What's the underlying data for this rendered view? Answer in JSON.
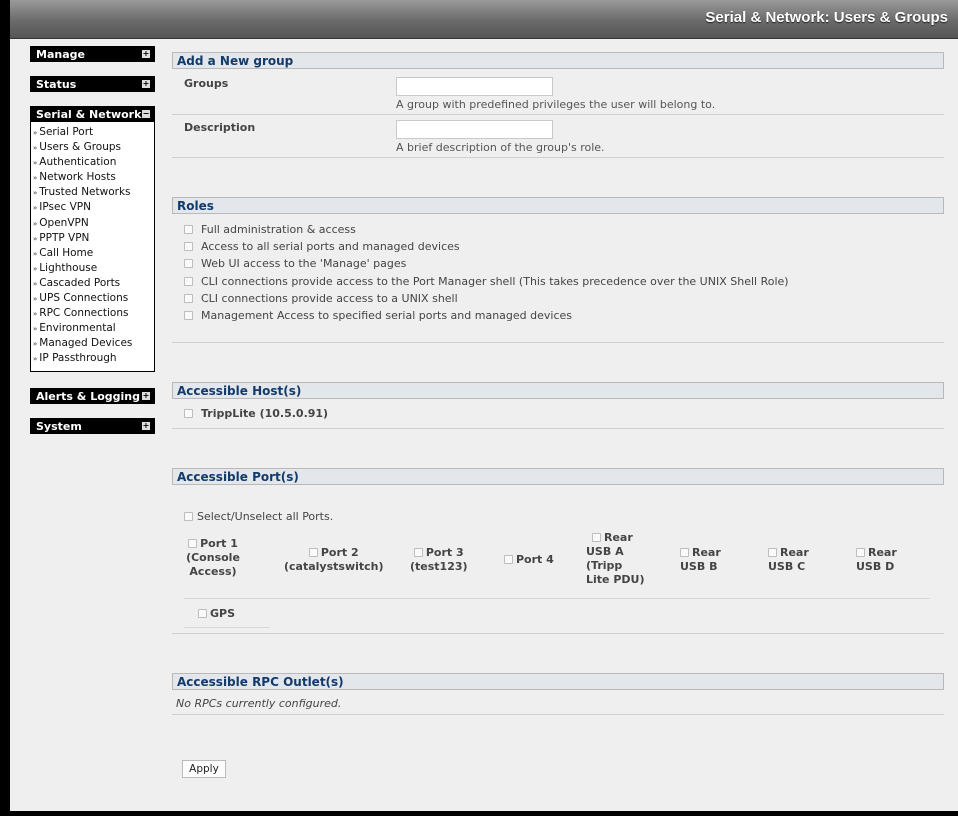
{
  "window": {
    "title": "Serial & Network: Users & Groups"
  },
  "sidebar": {
    "manage": "Manage",
    "status": "Status",
    "serial_network": "Serial & Network",
    "items": [
      "Serial Port",
      "Users & Groups",
      "Authentication",
      "Network Hosts",
      "Trusted Networks",
      "IPsec VPN",
      "OpenVPN",
      "PPTP VPN",
      "Call Home",
      "Lighthouse",
      "Cascaded Ports",
      "UPS Connections",
      "RPC Connections",
      "Environmental",
      "Managed Devices",
      "IP Passthrough"
    ],
    "alerts_logging": "Alerts & Logging",
    "system": "System",
    "toggle_collapsed": "+",
    "toggle_expanded": "−"
  },
  "add_group": {
    "heading": "Add a New group",
    "groups_label": "Groups",
    "groups_value": "",
    "groups_hint": "A group with predefined privileges the user will belong to.",
    "description_label": "Description",
    "description_value": "",
    "description_hint": "A brief description of the group's role."
  },
  "roles": {
    "heading": "Roles",
    "items": [
      "Full administration & access",
      "Access to all serial ports and managed devices",
      "Web UI access to the 'Manage' pages",
      "CLI connections provide access to the Port Manager shell (This takes precedence over the UNIX Shell Role)",
      "CLI connections provide access to a UNIX shell",
      "Management Access to specified serial ports and managed devices"
    ]
  },
  "hosts": {
    "heading": "Accessible Host(s)",
    "items": [
      "TrippLite (10.5.0.91)"
    ]
  },
  "ports": {
    "heading": "Accessible Port(s)",
    "select_all": "Select/Unselect all Ports.",
    "port1": {
      "l1": "Port 1",
      "l2": "(Console",
      "l3": "Access)"
    },
    "port2": {
      "l1": "Port 2",
      "l2": "(catalystswitch)"
    },
    "port3": {
      "l1": "Port 3",
      "l2": "(test123)"
    },
    "port4": {
      "l1": "Port 4"
    },
    "rear_usb_a": {
      "l1": "Rear",
      "l2": "USB A",
      "l3": "(Tripp",
      "l4": "Lite PDU)"
    },
    "rear_usb_b": {
      "l1": "Rear",
      "l2": "USB B"
    },
    "rear_usb_c": {
      "l1": "Rear",
      "l2": "USB C"
    },
    "rear_usb_d": {
      "l1": "Rear",
      "l2": "USB D"
    },
    "gps": "GPS"
  },
  "rpc": {
    "heading": "Accessible RPC Outlet(s)",
    "empty_text": "No RPCs currently configured."
  },
  "actions": {
    "apply": "Apply"
  }
}
